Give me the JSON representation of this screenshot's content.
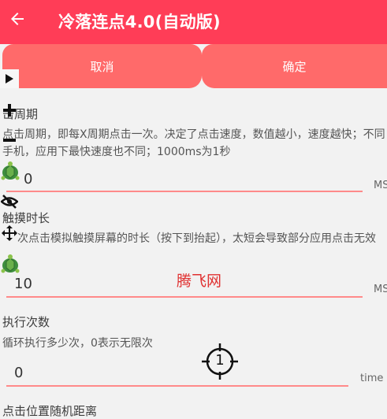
{
  "appbar": {
    "title": "冷落连点4.0(自动版)",
    "back_icon": "arrow-back-icon",
    "color": "#ff3d57"
  },
  "actions": {
    "cancel": "取消",
    "confirm": "确定",
    "button_color": "#ff6a6a"
  },
  "sections": {
    "click_period": {
      "label": "击周期",
      "desc": "点击周期，即每X周期点击一次。决定了点击速度，数值越小，速度越快；不同手机，应用下最快速度也不同；1000ms为1秒",
      "value": "0",
      "unit": "MS"
    },
    "touch_duration": {
      "label": "触摸时长",
      "desc": "次点击模拟触摸屏幕的时长（按下到抬起），太短会导致部分应用点击无效",
      "value": "10",
      "unit": "MS"
    },
    "repeat_count": {
      "label": "执行次数",
      "desc": "循环执行多少次，0表示无限次",
      "value": "0",
      "unit": "time"
    },
    "random_distance": {
      "label": "点击位置随机距离"
    }
  },
  "overlay": {
    "watermark": "腾飞网",
    "target_number": "1",
    "icons": [
      "play-icon",
      "plus-icon",
      "minus-icon",
      "turtle-icon",
      "eye-off-icon",
      "move-icon",
      "turtle-icon"
    ]
  }
}
